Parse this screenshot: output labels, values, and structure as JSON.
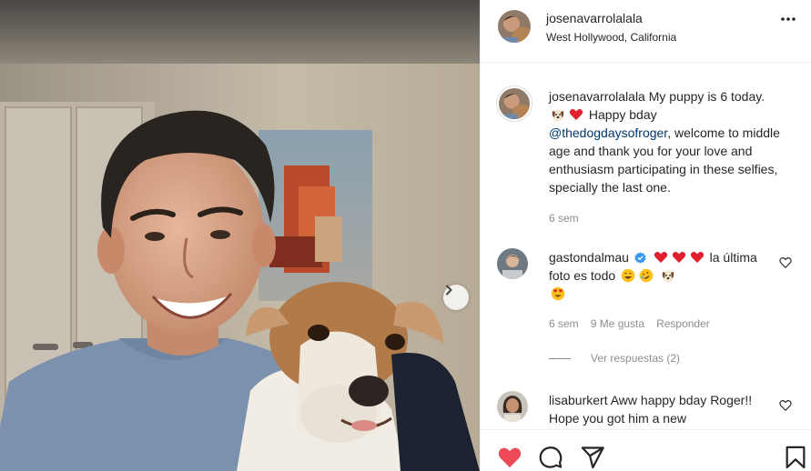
{
  "post": {
    "username": "josenavarrolalala",
    "location": "West Hollywood, California"
  },
  "caption": {
    "username": "josenavarrolalala",
    "text_1": "My puppy is 6 today.",
    "text_2": "Happy bday",
    "mention": "@thedogdaysofroger",
    "text_3": ", welcome to middle age and thank you for your love and enthusiasm participating in these selfies, specially the last one.",
    "time": "6 sem"
  },
  "comments": [
    {
      "username": "gastondalmau",
      "verified": true,
      "text_1": "la",
      "text_2": "última foto es todo",
      "time": "6 sem",
      "likes": "9 Me gusta",
      "reply": "Responder",
      "view_replies": "Ver respuestas (2)"
    },
    {
      "username": "lisaburkert",
      "text": "Aww happy bday Roger!! Hope you got him a new"
    }
  ],
  "icons": {
    "like": "heart-filled-icon",
    "comment": "comment-bubble-icon",
    "share": "paper-plane-icon",
    "save": "bookmark-icon",
    "more": "ellipsis-icon",
    "next": "chevron-right-icon",
    "verified": "verified-badge-icon"
  },
  "colors": {
    "like_red": "#ed4956",
    "verified_blue": "#3897f0",
    "mention_blue": "#00376b",
    "muted_gray": "#8e8e8e"
  }
}
